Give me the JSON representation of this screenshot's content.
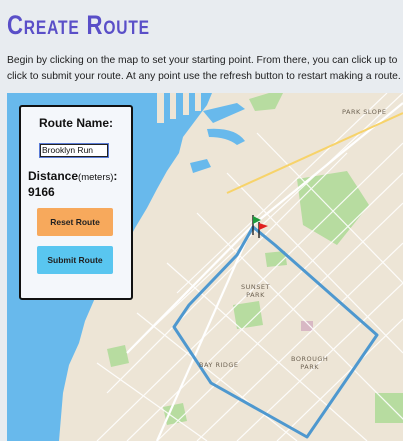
{
  "page": {
    "title": "Create Route",
    "instructions_line1": "Begin by clicking on the map to set your starting point. From there, you can click up to",
    "instructions_line2": "click to submit your route. At any point use the refresh button to restart making a route."
  },
  "panel": {
    "route_name_label": "Route Name:",
    "route_name_value": "Brooklyn Run",
    "distance_label": "Distance",
    "distance_unit": "(meters)",
    "distance_colon": ":",
    "distance_value": "9166",
    "reset_button": "Reset Route",
    "submit_button": "Submit Route"
  },
  "map": {
    "labels": {
      "park_slope": "PARK SLOPE",
      "sunset_park": "SUNSET\nPARK",
      "borough_park": "BOROUGH\nPARK",
      "bay_ridge": "BAY RIDGE"
    },
    "icons": [
      "start-flag-icon",
      "end-flag-icon"
    ],
    "colors": {
      "water": "#68b9ec",
      "land": "#ede5d6",
      "park": "#b7dca0",
      "route": "#4e98cf",
      "start_flag": "#1f9b3c",
      "end_flag": "#e02020"
    }
  }
}
